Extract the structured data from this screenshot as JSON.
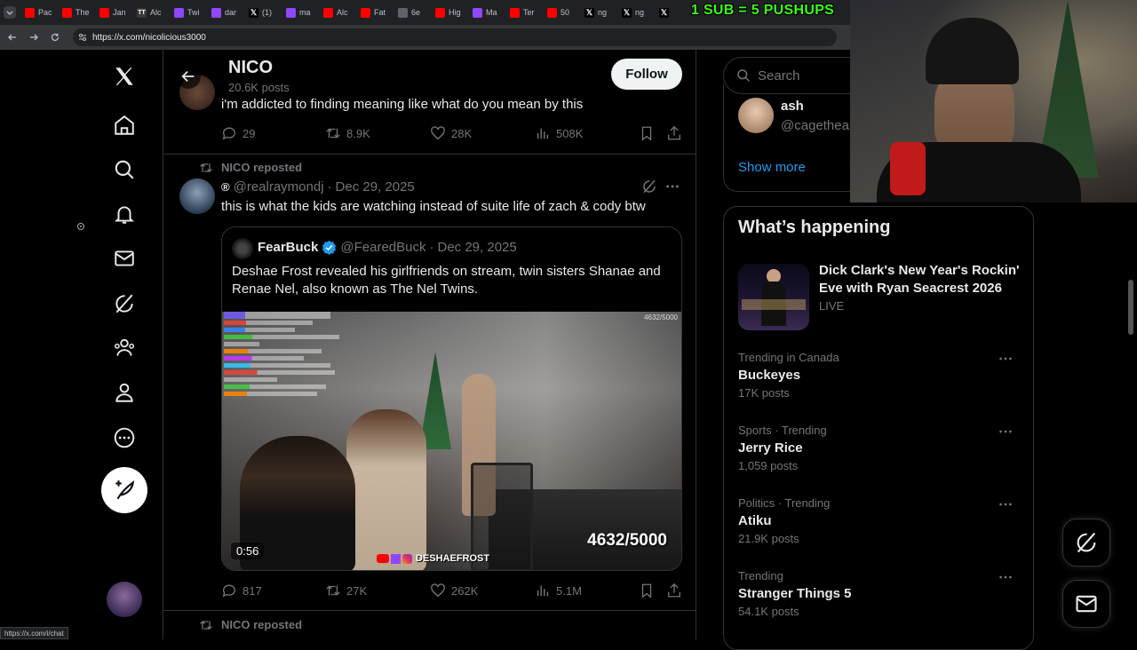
{
  "browser": {
    "tabs": [
      {
        "label": "Pac",
        "icon": "youtube-icon",
        "color": "#ff0000"
      },
      {
        "label": "The",
        "icon": "youtube-icon",
        "color": "#ff0000"
      },
      {
        "label": "Jan",
        "icon": "youtube-icon",
        "color": "#ff0000"
      },
      {
        "label": "Alc",
        "icon": "tt-icon",
        "color": "#3a3a3a"
      },
      {
        "label": "Twi",
        "icon": "twitch-icon",
        "color": "#9146ff"
      },
      {
        "label": "dar",
        "icon": "twitch-icon",
        "color": "#9146ff"
      },
      {
        "label": "(1)",
        "icon": "x-icon",
        "color": "#000000"
      },
      {
        "label": "ma",
        "icon": "twitch-icon",
        "color": "#9146ff"
      },
      {
        "label": "Alc",
        "icon": "youtube-icon",
        "color": "#ff0000"
      },
      {
        "label": "Fat",
        "icon": "youtube-icon",
        "color": "#ff0000"
      },
      {
        "label": "6e",
        "icon": "globe-icon",
        "color": "#5f6368"
      },
      {
        "label": "Hig",
        "icon": "youtube-icon",
        "color": "#ff0000"
      },
      {
        "label": "Ma",
        "icon": "twitch-icon",
        "color": "#9146ff"
      },
      {
        "label": "Ter",
        "icon": "youtube-icon",
        "color": "#ff0000"
      },
      {
        "label": "50",
        "icon": "youtube-icon",
        "color": "#ff0000"
      },
      {
        "label": "ng",
        "icon": "x-icon",
        "color": "#000000"
      },
      {
        "label": "ng",
        "icon": "x-icon",
        "color": "#000000"
      },
      {
        "label": "",
        "icon": "x-icon",
        "color": "#000000"
      }
    ],
    "url": "https://x.com/nicolicious3000",
    "status_url": "https://x.com/i/chat"
  },
  "overlay_text": "1 SUB = 5 PUSHUPS",
  "profile": {
    "name": "NICO",
    "posts": "20.6K posts",
    "follow_label": "Follow"
  },
  "post1": {
    "text": "i'm addicted to finding meaning like what do you mean by this",
    "replies": "29",
    "reposts": "8.9K",
    "likes": "28K",
    "views": "508K"
  },
  "post2": {
    "reposted_by": "NICO reposted",
    "handle": "@realraymondj",
    "date": "Dec 29, 2025",
    "text": "this is what the kids are watching instead of suite life of zach & cody btw",
    "quote": {
      "name": "FearBuck",
      "handle": "@FearedBuck",
      "date": "Dec 29, 2025",
      "text": "Deshae Frost revealed his girlfriends on stream, twin sisters Shanae and Renae Nel, also known as The Nel Twins.",
      "video_duration": "0:56",
      "video_counter_small": "4632/5000",
      "video_counter_big": "4632/5000",
      "video_tag": "DESHAEFROST"
    },
    "replies": "817",
    "reposts": "27K",
    "likes": "262K",
    "views": "5.1M"
  },
  "post3": {
    "reposted_by": "NICO reposted"
  },
  "sidebar": {
    "search_placeholder": "Search",
    "who_name": "ash",
    "who_handle": "@cagetheas",
    "show_more": "Show more",
    "happening_title": "What’s happening",
    "event": {
      "title": "Dick Clark's New Year's Rockin' Eve with Ryan Seacrest 2026",
      "status": "LIVE"
    },
    "trends": [
      {
        "context": "Trending in Canada",
        "name": "Buckeyes",
        "count": "17K posts"
      },
      {
        "context": "Sports · Trending",
        "name": "Jerry Rice",
        "count": "1,059 posts"
      },
      {
        "context": "Politics · Trending",
        "name": "Atiku",
        "count": "21.9K posts"
      },
      {
        "context": "Trending",
        "name": "Stranger Things 5",
        "count": "54.1K posts"
      }
    ]
  }
}
